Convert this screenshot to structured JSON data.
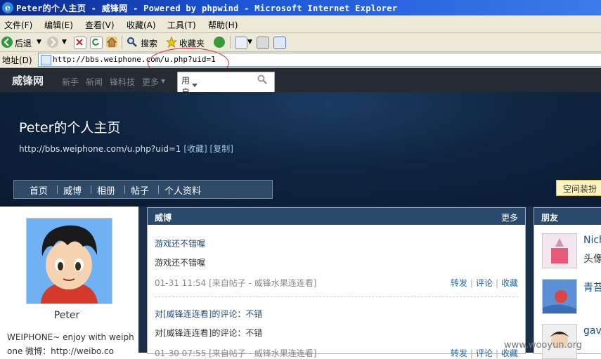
{
  "window": {
    "title": "Peter的个人主页 - 威锋网 - Powered by phpwind - Microsoft Internet Explorer"
  },
  "menubar": [
    "文件(F)",
    "编辑(E)",
    "查看(V)",
    "收藏(A)",
    "工具(T)",
    "帮助(H)"
  ],
  "toolbar": {
    "back": "后退",
    "search": "搜索",
    "favorites": "收藏夹"
  },
  "address": {
    "label": "地址(D)",
    "url": "http://bbs.weiphone.com/u.php?uid=1"
  },
  "sitenav": {
    "logo": "威锋网",
    "links": [
      "新手",
      "新闻",
      "锋科技",
      "更多"
    ]
  },
  "search": {
    "scope": "用户"
  },
  "profile_header": {
    "title": "Peter的个人主页",
    "url": "http://bbs.weiphone.com/u.php?uid=1",
    "collect": "[收藏]",
    "copy": "[复制]"
  },
  "tabs": [
    "首页",
    "威博",
    "相册",
    "帖子",
    "个人资料"
  ],
  "decorate_button": "空间装扮",
  "profile": {
    "name": "Peter",
    "bio_line1": "WEIPHONE~  enjoy with weiph",
    "bio_line2": "one   微博：http://weibo.co"
  },
  "weibo": {
    "heading": "威博",
    "more": "更多",
    "posts": [
      {
        "title": "游戏还不错喔",
        "body": "游戏还不错喔",
        "meta": "01-31 11:54 [来自帖子 - 威锋水果连连看]",
        "actions": [
          "转发",
          "评论",
          "收藏"
        ]
      },
      {
        "title": "对[威锋连连看]的评论：不错",
        "body": "对[威锋连连看]的评论：不错",
        "meta": "01-30 07:55 [来自帖子 - 威锋水果连连看]",
        "actions": [
          "转发",
          "评论",
          "收藏"
        ]
      }
    ]
  },
  "friends": {
    "heading": "朋友",
    "items": [
      {
        "name": "Nich",
        "sub": "头像"
      },
      {
        "name": "青苔",
        "sub": ""
      },
      {
        "name": "gav",
        "sub": ""
      }
    ]
  },
  "watermark": "www.wooyun.org",
  "colors": {
    "titlebar": "#1d55d6",
    "nav_bg": "#242b33",
    "hero_bg": "#0f2440",
    "panel_header": "#29496d",
    "link": "#1f6aa8",
    "annotation": "#d22233"
  },
  "icons": [
    "ie-logo-icon",
    "back-icon",
    "forward-icon",
    "stop-icon",
    "refresh-icon",
    "home-icon",
    "search-icon",
    "favorites-star-icon",
    "media-icon",
    "mail-icon",
    "print-icon",
    "edit-icon",
    "page-icon",
    "magnifier-icon"
  ]
}
